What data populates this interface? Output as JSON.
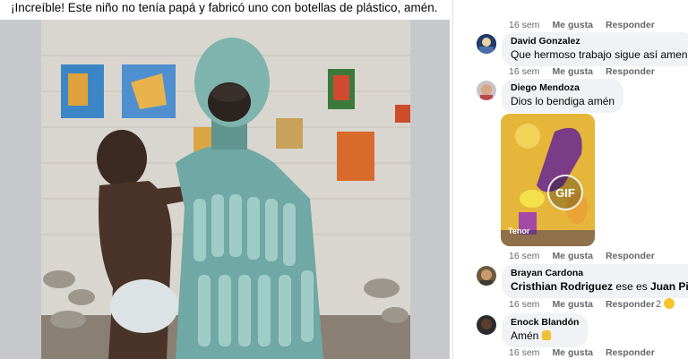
{
  "post": {
    "caption": "¡Increíble! Este niño no tenía papá y fabricó uno con botellas de plástico, amén."
  },
  "comments": [
    {
      "time": "16 sem",
      "like": "Me gusta",
      "reply": "Responder"
    },
    {
      "author": "David Gonzalez",
      "text": "Que hermoso trabajo sigue así amen",
      "time": "16 sem",
      "like": "Me gusta",
      "reply": "Responder"
    },
    {
      "author": "Diego Mendoza",
      "text": "Dios lo bendiga amén",
      "gif_label": "Tenor",
      "gif_badge": "GIF",
      "time": "16 sem",
      "like": "Me gusta",
      "reply": "Responder"
    },
    {
      "author": "Brayan Cardona",
      "mention1": "Cristhian Rodriguez",
      "middle": " ese es ",
      "mention2": "Juan Pino",
      "time": "16 sem",
      "like": "Me gusta",
      "reply": "Responder",
      "reaction_count": "2"
    },
    {
      "author": "Enock Blandón",
      "text": "Amén",
      "time": "16 sem",
      "like": "Me gusta",
      "reply": "Responder"
    }
  ]
}
